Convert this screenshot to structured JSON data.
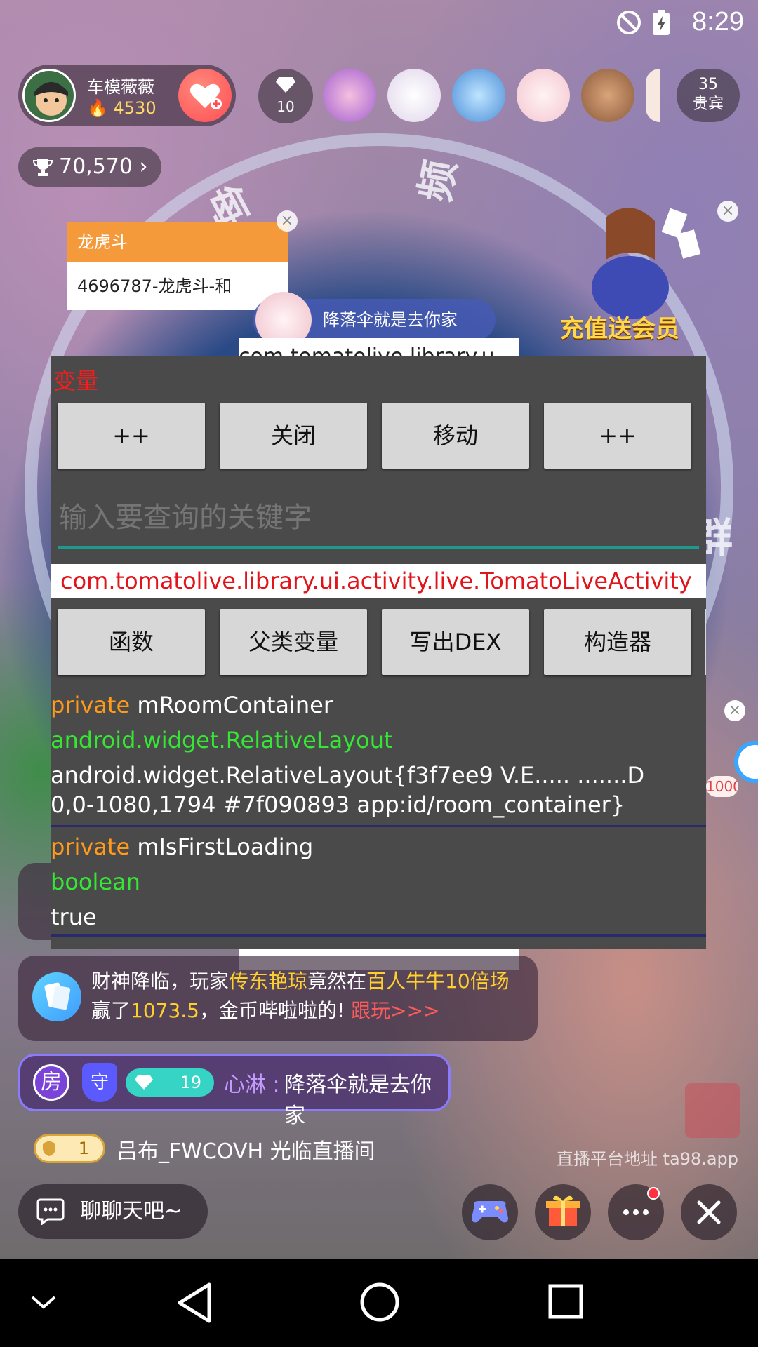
{
  "status_bar": {
    "time": "8:29"
  },
  "host": {
    "name": "车模薇薇",
    "score": "4530"
  },
  "viewers": {
    "count": "10",
    "vip_count": "35",
    "vip_label": "贵宾"
  },
  "trophy": {
    "value": "70,570"
  },
  "lhd_popup": {
    "title": "龙虎斗",
    "body": "4696787-龙虎斗-和"
  },
  "banner_message": {
    "text": "降落伞就是去你家"
  },
  "promo": {
    "text": "充值送会员"
  },
  "tool_panel": {
    "label": "变量",
    "top_buttons": [
      "++",
      "关闭",
      "移动",
      "++"
    ],
    "search_placeholder": "输入要查询的关键字",
    "class_name": "com.tomatolive.library.ui.activity.live.TomatoLiveActivity",
    "action_buttons": [
      "函数",
      "父类变量",
      "写出DEX",
      "构造器"
    ],
    "fields": [
      {
        "modifier": "private",
        "name": "mRoomContainer",
        "type": "android.widget.RelativeLayout",
        "value_line1": "android.widget.RelativeLayout{f3f7ee9 V.E..... .......D",
        "value_line2": "0,0-1080,1794 #7f090893 app:id/room_container}"
      },
      {
        "modifier": "private",
        "name": "mIsFirstLoading",
        "type": "boolean",
        "value_line1": "true"
      }
    ]
  },
  "overlay_strip_text": "com.tomatolive.library.u",
  "side_badge": "1000",
  "chat": {
    "msg1": {
      "p1": "财神降临，玩家",
      "player": "传东艳琼",
      "p2": "竟然在",
      "game": "百人牛牛10倍场",
      "p3": "赢了",
      "amount": "1073.5",
      "p4": "，金币哔啦啦的! ",
      "follow": "跟玩>>>"
    },
    "msg2": {
      "badge_room": "房",
      "badge_guard": "守",
      "level": "19",
      "user": "心淋",
      "colon": " : ",
      "text": "降落伞就是去你家"
    },
    "welcome": {
      "level": "1",
      "text": "吕布_FWCOVH 光临直播间"
    }
  },
  "watermark": {
    "platform": "直播平台地址 ta98.app"
  },
  "bottom_bar": {
    "chat_placeholder": "聊聊天吧~"
  },
  "colors": {
    "accent_teal": "#1c9a8f",
    "class_red": "#e0141a",
    "keyword_orange": "#ff9a1a",
    "type_green": "#35e635"
  }
}
